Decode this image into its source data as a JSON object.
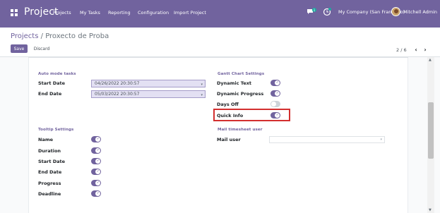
{
  "navbar": {
    "brand": "Project",
    "menu": [
      "Projects",
      "My Tasks",
      "Reporting",
      "Configuration",
      "Import Project"
    ],
    "chat_badge": "1",
    "company": "My Company (San Francisco)",
    "user": "Mitchell Admin",
    "bg_color": "#71639e"
  },
  "breadcrumb": {
    "parent": "Projects",
    "separator": "/",
    "current": "Proxecto de Proba"
  },
  "buttons": {
    "save": "Save",
    "discard": "Discard"
  },
  "pager": {
    "value": "2 / 6",
    "prev": "‹",
    "next": "›"
  },
  "auto_mode": {
    "title": "Auto mode tasks",
    "start_label": "Start Date",
    "start_value": "04/26/2022 20:30:57",
    "end_label": "End Date",
    "end_value": "05/03/2022 20:30:57"
  },
  "gantt": {
    "title": "Gantt Chart Settings",
    "items": [
      {
        "label": "Dynamic Text",
        "on": true
      },
      {
        "label": "Dynamic Progress",
        "on": true
      },
      {
        "label": "Days Off",
        "on": false
      },
      {
        "label": "Quick Info",
        "on": true
      }
    ]
  },
  "tooltip": {
    "title": "Tooltip Settings",
    "items": [
      {
        "label": "Name",
        "on": true
      },
      {
        "label": "Duration",
        "on": true
      },
      {
        "label": "Start Date",
        "on": true
      },
      {
        "label": "End Date",
        "on": true
      },
      {
        "label": "Progress",
        "on": true
      },
      {
        "label": "Deadline",
        "on": true
      }
    ]
  },
  "mail": {
    "title": "Mail timesheet user",
    "label": "Mail user",
    "value": ""
  },
  "colors": {
    "accent": "#71639e",
    "highlight": "#d32f2f"
  }
}
